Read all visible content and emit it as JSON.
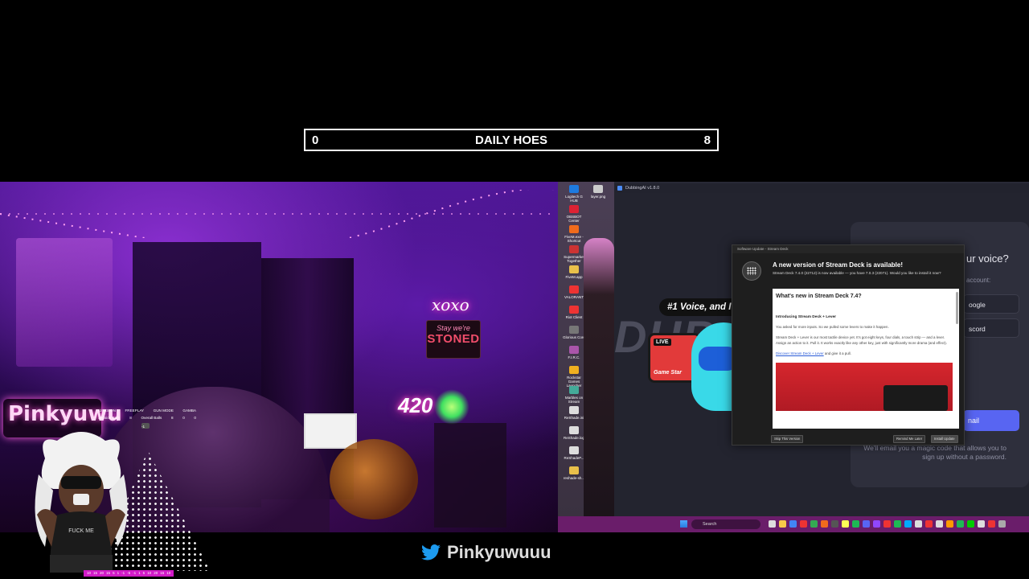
{
  "counter": {
    "left_value": "0",
    "title": "DAILY HOES",
    "right_value": "8"
  },
  "webcam": {
    "signs": {
      "xoxo": "xoxo",
      "stoned_top": "Stay we're",
      "stoned_bottom": "STONED",
      "four_twenty": "420",
      "name_sign": "Pinkyuwu"
    }
  },
  "stats_overlay": {
    "row1": [
      "KINKS ON",
      "FREEPLAY",
      "GUN MODE",
      "GAMBA"
    ],
    "row2": [
      "Session Balls",
      "8",
      "Overall Balls",
      "8",
      "0",
      "0"
    ],
    "chip_label": "-1"
  },
  "avatar": {
    "shirt_text": "FUCK ME"
  },
  "number_strip": [
    "10",
    "15",
    "20",
    "15",
    "5",
    "1",
    "-1",
    "-5",
    "-1",
    "1",
    "5",
    "10",
    "20",
    "15",
    "10"
  ],
  "desktop_icons": [
    {
      "label": "Logitech G HUB",
      "color": "#1e7be0"
    },
    {
      "label": "layer.png",
      "color": "#ccc"
    },
    {
      "label": "OBSBOT Center",
      "color": "#d23"
    },
    {
      "label": "FiveM.exe - Shortcut",
      "color": "#f06b1c"
    },
    {
      "label": "Supermarket Together",
      "color": "#c33"
    },
    {
      "label": "FiveM.app",
      "color": "#e9c04a"
    },
    {
      "label": "VALORANT",
      "color": "#e33"
    },
    {
      "label": "Riot Client",
      "color": "#e33"
    },
    {
      "label": "Glorious Core",
      "color": "#777"
    },
    {
      "label": "F.I.R.C.",
      "color": "#a5a"
    },
    {
      "label": "Rockstar Games Launcher",
      "color": "#f0b020"
    },
    {
      "label": "Marbles on Stream",
      "color": "#4a9"
    },
    {
      "label": "ReShade.ini",
      "color": "#ddd"
    },
    {
      "label": "ReShade.log",
      "color": "#ddd"
    },
    {
      "label": "ReShadeP...",
      "color": "#ddd"
    },
    {
      "label": "reshade-sh...",
      "color": "#e9c04a"
    }
  ],
  "app": {
    "title": "DubbingAI v1.8.0",
    "tagline": "#1 Voice, and Its F",
    "brand_big": "DUB",
    "live_badge": "LIVE",
    "live_caption": "Game Star",
    "login": {
      "question": "ur voice?",
      "account_label": "account:",
      "google_label": "oogle",
      "discord_label": "scord",
      "email_button": "nail",
      "note": "We'll email you a magic code that allows you to sign up without a password."
    }
  },
  "dialog": {
    "window_title": "Software Update - Stream Deck",
    "headline": "A new version of Stream Deck is available!",
    "subtext": "Stream Deck 7.4.0 (22712) is now available — you have 7.0.3 (22071). Would you like to install it now?",
    "notes_title": "What's new in Stream Deck 7.4?",
    "section_title": "Introducing Stream Deck + Lever",
    "para1": "You asked for more inputs. So we pulled some levers to make it happen.",
    "para2": "Stream Deck + Lever is our most tactile device yet. It's got eight keys, four dials, a touch strip — and a lever. Assign an action to it. Pull it. It works exactly like any other key, just with significantly more drama (and effect).",
    "link_text": "Discover Stream Deck + Lever",
    "link_suffix": " and give it a pull.",
    "skip_button": "Skip This Version",
    "remind_button": "Remind Me Later",
    "install_button": "Install Update"
  },
  "taskbar": {
    "search_placeholder": "Search"
  },
  "social": {
    "handle": "Pinkyuwuuu"
  }
}
